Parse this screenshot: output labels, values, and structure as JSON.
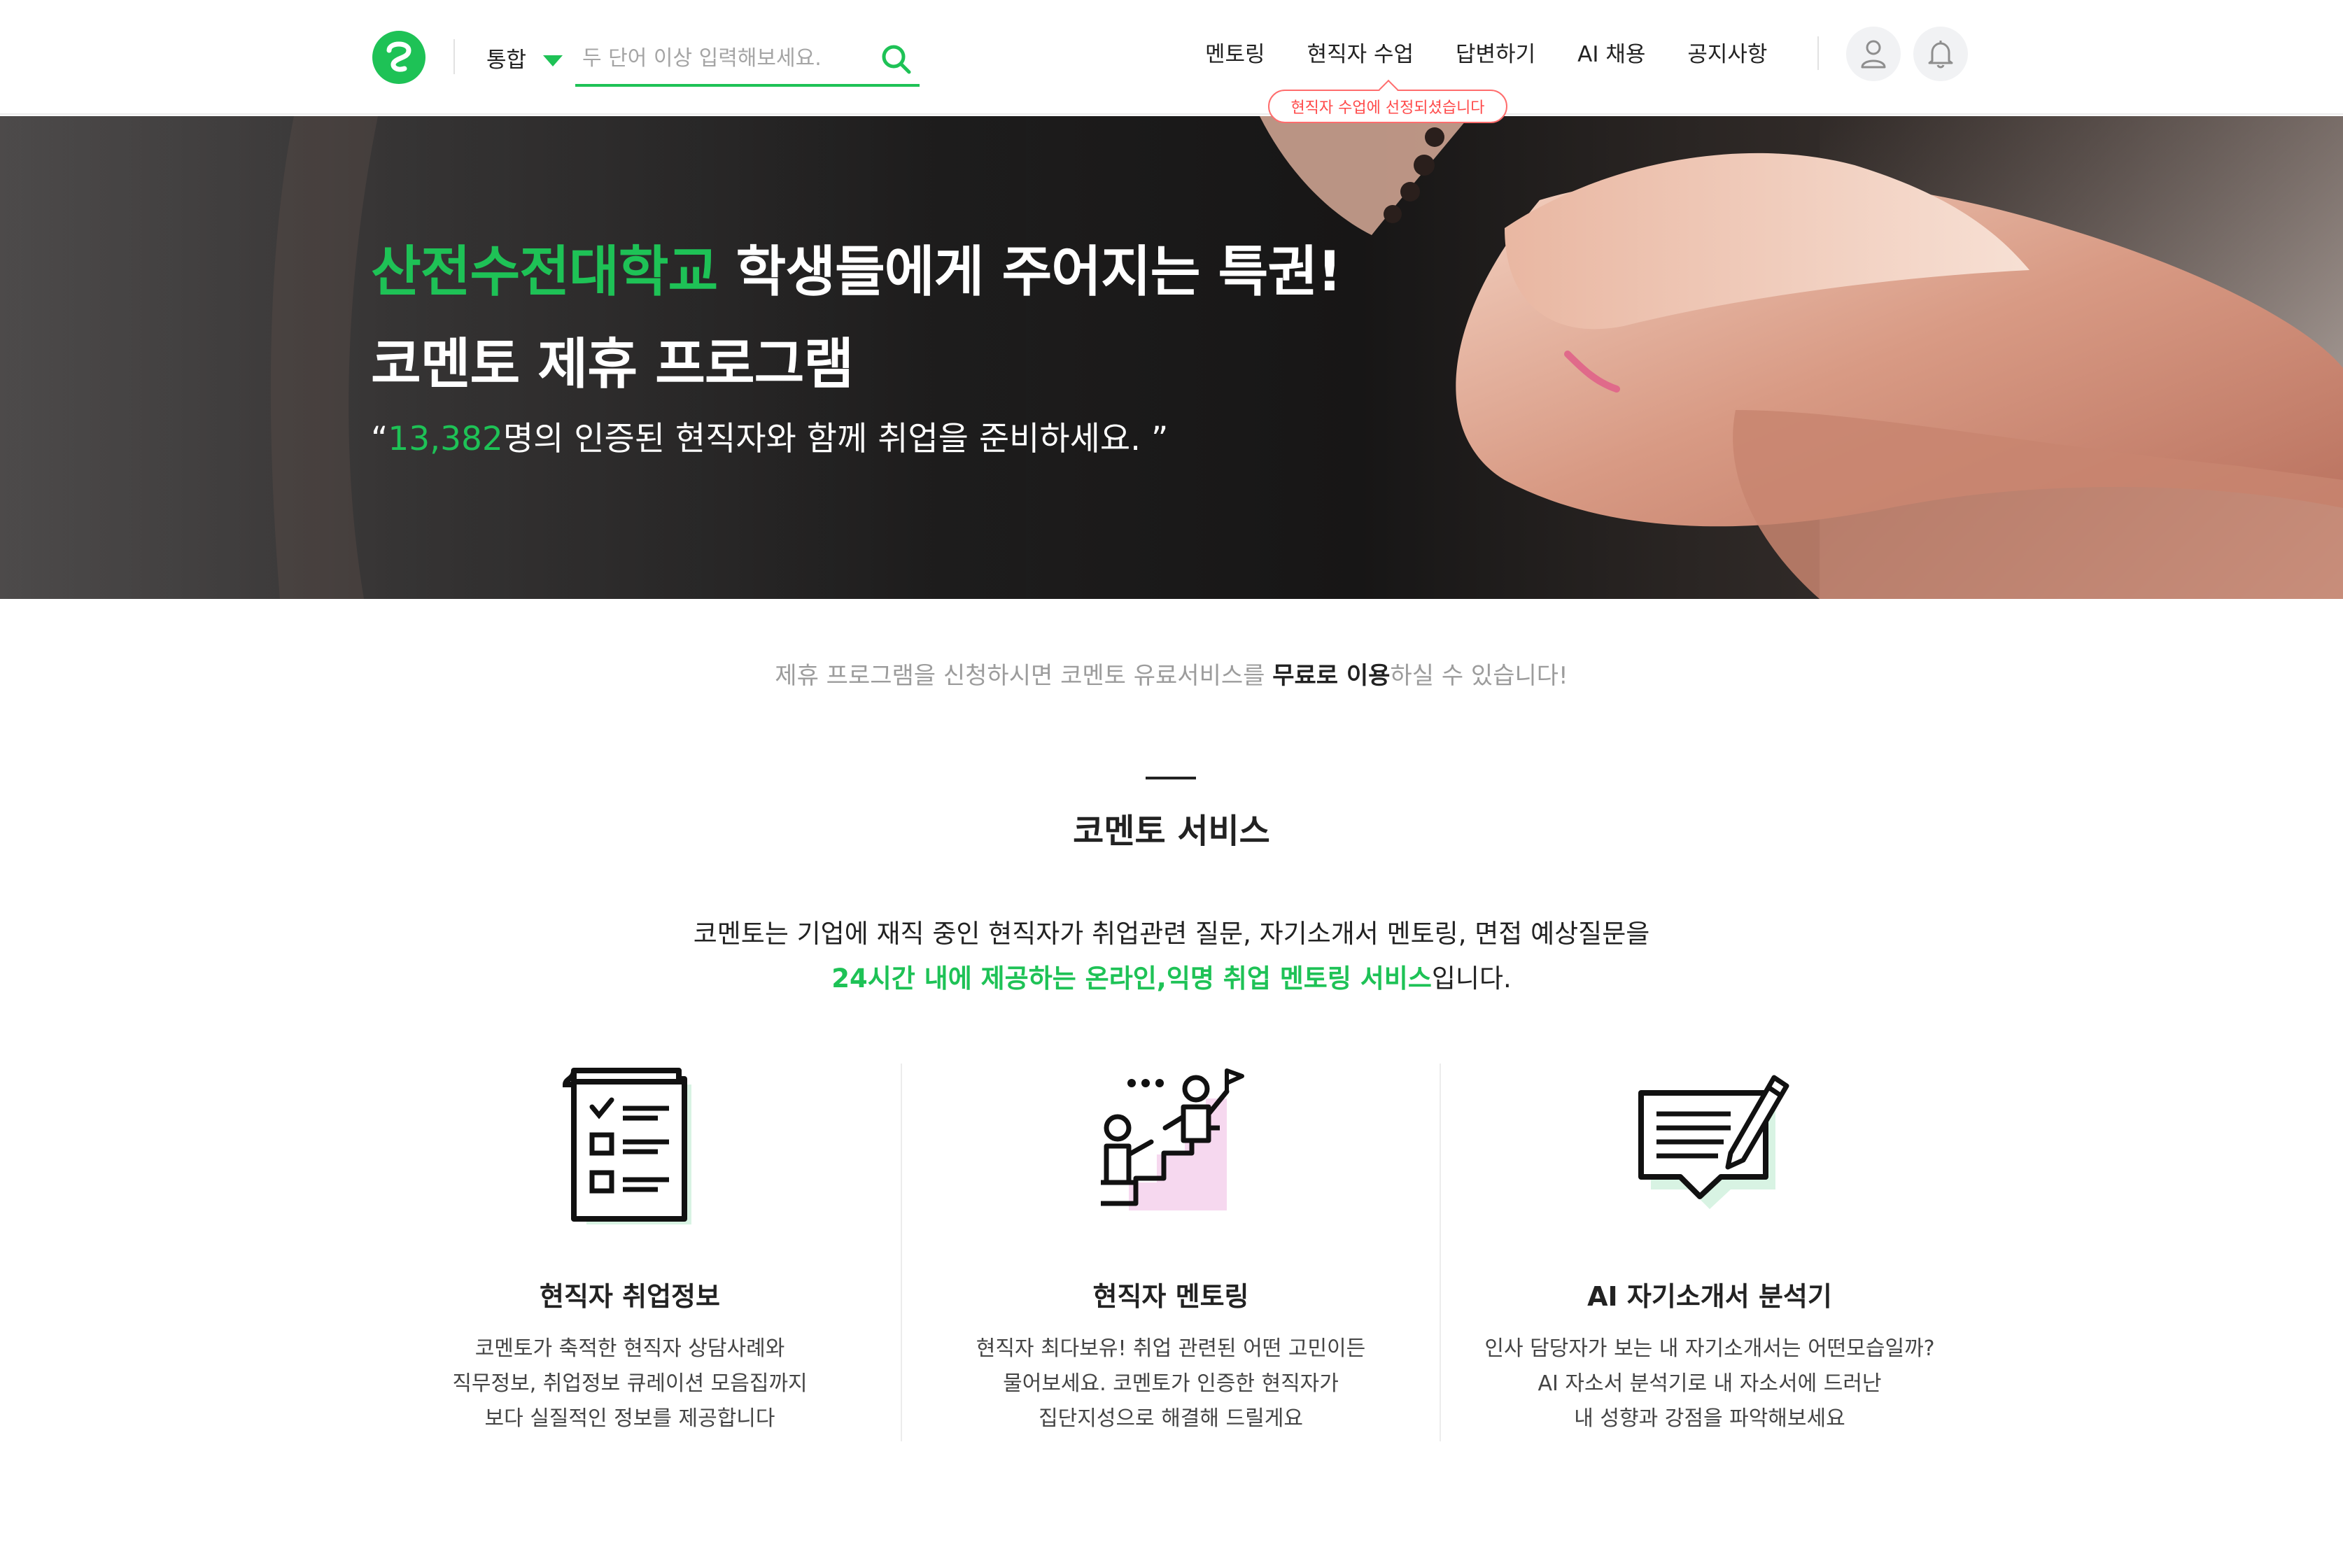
{
  "brand": {
    "accent": "#1ec256",
    "alert": "#ff4a4a"
  },
  "header": {
    "logo_icon": "cometo-logo",
    "scope_label": "통합",
    "search_placeholder": "두 단어 이상 입력해보세요.",
    "search_icon": "search-icon",
    "nav": [
      "멘토링",
      "현직자 수업",
      "답변하기",
      "AI 채용",
      "공지사항"
    ],
    "tooltip": "현직자 수업에 선정되셨습니다",
    "user_icon": "user-icon",
    "bell_icon": "bell-icon"
  },
  "hero": {
    "line1_green": "산전수전대학교",
    "line1_white": " 학생들에게 주어지는 특권!",
    "line2": "코멘토 제휴 프로그램",
    "quote_open": "“",
    "quote_count": "13,382",
    "quote_rest": "명의 인증된 현직자와 함께 취업을 준비하세요. ”"
  },
  "intro": {
    "pre": "제휴 프로그램을 신청하시면 코멘토 유료서비스를 ",
    "bold": "무료로 이용",
    "post": "하실 수 있습니다!"
  },
  "service": {
    "title": "코멘토 서비스",
    "desc_line1": "코멘토는 기업에 재직 중인 현직자가 취업관련 질문, 자기소개서 멘토링, 면접 예상질문을",
    "desc_line2_green": "24시간 내에 제공하는 온라인,익명 취업 멘토링 서비스",
    "desc_line2_rest": "입니다.",
    "cards": [
      {
        "icon": "checklist-icon",
        "title": "현직자 취업정보",
        "lines": [
          "코멘토가 축적한 현직자 상담사례와",
          "직무정보, 취업정보 큐레이션 모음집까지",
          "보다 실질적인 정보를 제공합니다"
        ]
      },
      {
        "icon": "mentoring-stairs-icon",
        "title": "현직자 멘토링",
        "lines": [
          "현직자 최다보유! 취업 관련된 어떤 고민이든",
          "물어보세요. 코멘토가 인증한 현직자가",
          "집단지성으로 해결해 드릴게요"
        ]
      },
      {
        "icon": "document-pen-icon",
        "title": "AI 자기소개서 분석기",
        "lines": [
          "인사 담당자가 보는 내 자기소개서는 어떤모습일까?",
          "AI 자소서 분석기로 내 자소서에 드러난",
          "내 성향과 강점을 파악해보세요"
        ]
      }
    ]
  }
}
